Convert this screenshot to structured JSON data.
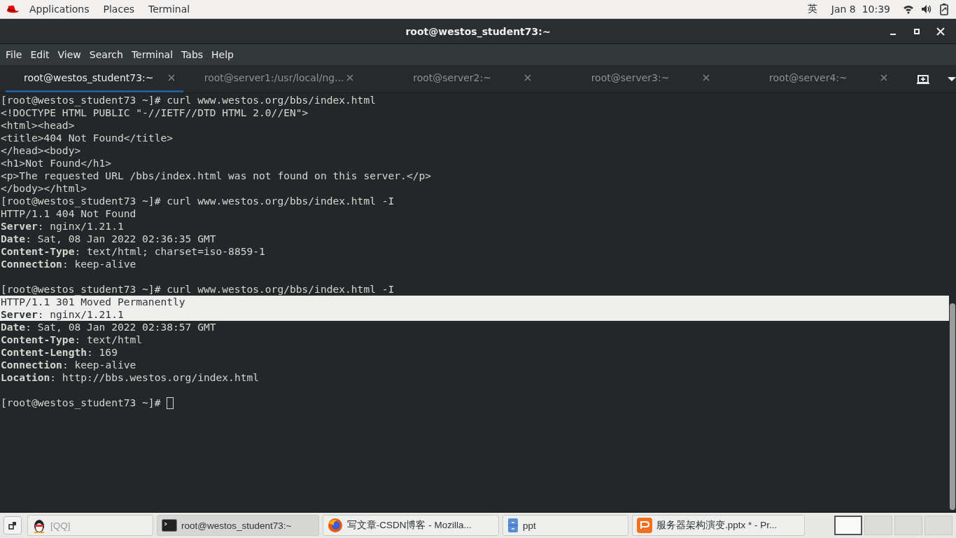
{
  "top_bar": {
    "menus": [
      "Applications",
      "Places",
      "Terminal"
    ],
    "input_method": "英",
    "clock": "Jan 8  10:39"
  },
  "window": {
    "title": "root@westos_student73:~"
  },
  "menu_bar": [
    "File",
    "Edit",
    "View",
    "Search",
    "Terminal",
    "Tabs",
    "Help"
  ],
  "tabs": [
    {
      "label": "root@westos_student73:~",
      "selected": true
    },
    {
      "label": "root@server1:/usr/local/ng...",
      "selected": false
    },
    {
      "label": "root@server2:~",
      "selected": false
    },
    {
      "label": "root@server3:~",
      "selected": false
    },
    {
      "label": "root@server4:~",
      "selected": false
    }
  ],
  "terminal": {
    "lines": [
      {
        "kind": "text",
        "text": "[root@westos_student73 ~]# curl www.westos.org/bbs/index.html",
        "selected": false
      },
      {
        "kind": "text",
        "text": "<!DOCTYPE HTML PUBLIC \"-//IETF//DTD HTML 2.0//EN\">",
        "selected": false
      },
      {
        "kind": "text",
        "text": "<html><head>",
        "selected": false
      },
      {
        "kind": "text",
        "text": "<title>404 Not Found</title>",
        "selected": false
      },
      {
        "kind": "text",
        "text": "</head><body>",
        "selected": false
      },
      {
        "kind": "text",
        "text": "<h1>Not Found</h1>",
        "selected": false
      },
      {
        "kind": "text",
        "text": "<p>The requested URL /bbs/index.html was not found on this server.</p>",
        "selected": false
      },
      {
        "kind": "text",
        "text": "</body></html>",
        "selected": false
      },
      {
        "kind": "text",
        "text": "[root@westos_student73 ~]# curl www.westos.org/bbs/index.html -I",
        "selected": false
      },
      {
        "kind": "text",
        "text": "HTTP/1.1 404 Not Found",
        "selected": false
      },
      {
        "kind": "text",
        "text": "**Server**: nginx/1.21.1",
        "selected": false
      },
      {
        "kind": "text",
        "text": "**Date**: Sat, 08 Jan 2022 02:36:35 GMT",
        "selected": false
      },
      {
        "kind": "text",
        "text": "**Content-Type**: text/html; charset=iso-8859-1",
        "selected": false
      },
      {
        "kind": "text",
        "text": "**Connection**: keep-alive",
        "selected": false
      },
      {
        "kind": "blank",
        "selected": false
      },
      {
        "kind": "text",
        "text": "[root@westos_student73 ~]# curl www.westos.org/bbs/index.html -I",
        "selected": false
      },
      {
        "kind": "text",
        "text": "HTTP/1.1 301 Moved Permanently",
        "selected": true
      },
      {
        "kind": "text",
        "text": "**Server**: nginx/1.21.1",
        "selected": true
      },
      {
        "kind": "text",
        "text": "**Date**: Sat, 08 Jan 2022 02:38:57 GMT",
        "selected": false
      },
      {
        "kind": "text",
        "text": "**Content-Type**: text/html",
        "selected": false
      },
      {
        "kind": "text",
        "text": "**Content-Length**: 169",
        "selected": false
      },
      {
        "kind": "text",
        "text": "**Connection**: keep-alive",
        "selected": false
      },
      {
        "kind": "text",
        "text": "**Location**: http://bbs.westos.org/index.html",
        "selected": false
      },
      {
        "kind": "blank",
        "selected": false
      },
      {
        "kind": "cursor",
        "text": "[root@westos_student73 ~]#",
        "selected": false
      }
    ]
  },
  "taskbar": {
    "items": [
      {
        "kind": "penguin",
        "label": "[QQ]",
        "selected": false
      },
      {
        "kind": "terminal",
        "label": "root@westos_student73:~",
        "selected": true
      },
      {
        "kind": "browser",
        "label": "写文章-CSDN博客 - Mozilla...",
        "selected": false
      },
      {
        "kind": "cabinet",
        "label": "ppt",
        "selected": false
      },
      {
        "kind": "slides",
        "label": "服务器架构演变.pptx * - Pr...",
        "selected": false
      }
    ],
    "workspaces": [
      {
        "selected": true
      },
      {
        "selected": false
      },
      {
        "selected": false
      },
      {
        "selected": false
      }
    ]
  }
}
